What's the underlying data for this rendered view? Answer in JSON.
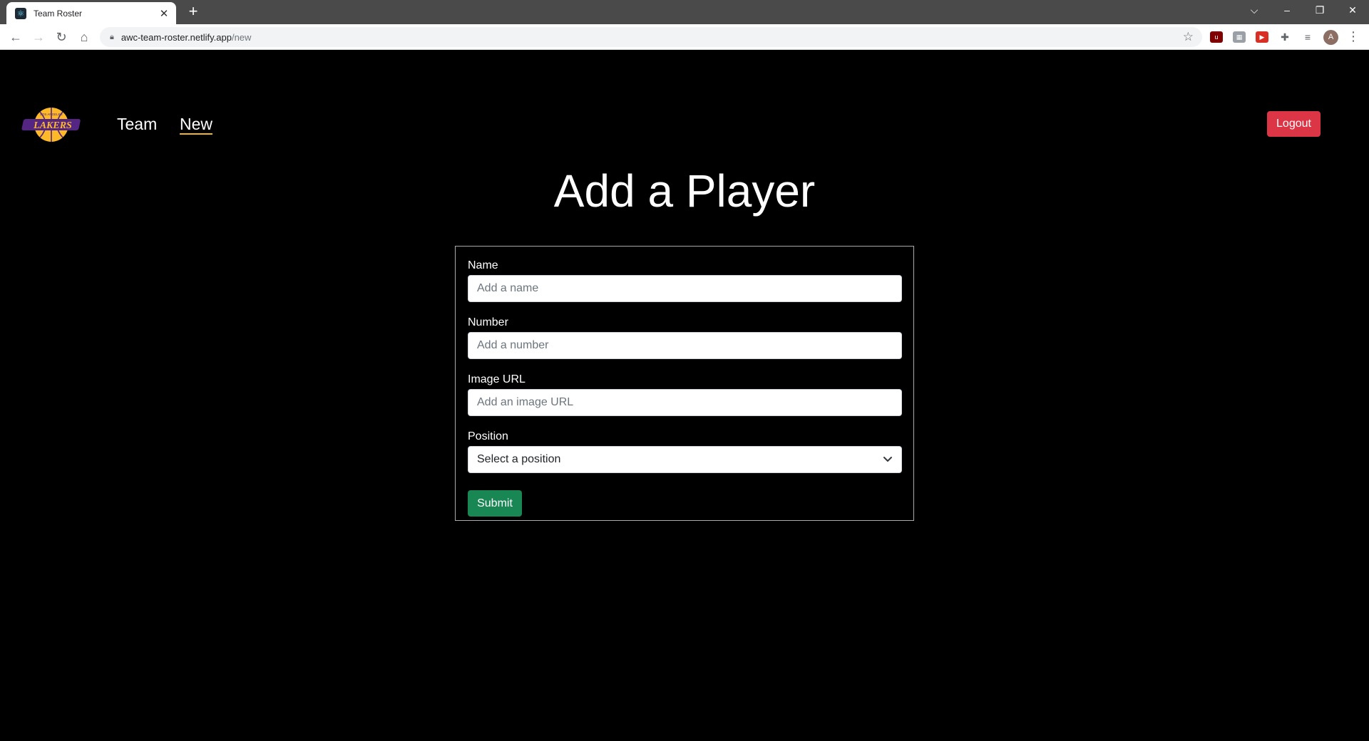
{
  "browser": {
    "tab_title": "Team Roster",
    "tab_close": "✕",
    "new_tab": "+",
    "url_host": "awc-team-roster.netlify.app",
    "url_path": "/new",
    "avatar_letter": "A",
    "window_controls": {
      "dropdown": "⌵",
      "minimize": "–",
      "restore": "❐",
      "close": "✕"
    },
    "extensions": [
      "ublock-icon",
      "grid-icon",
      "youtube-icon",
      "puzzle-icon",
      "queue-icon"
    ]
  },
  "nav": {
    "logo_alt": "Lakers logo",
    "links": [
      {
        "label": "Team"
      },
      {
        "label": "New",
        "active": true
      }
    ],
    "logout_label": "Logout"
  },
  "page": {
    "title": "Add a Player"
  },
  "form": {
    "name": {
      "label": "Name",
      "placeholder": "Add a name",
      "value": ""
    },
    "number": {
      "label": "Number",
      "placeholder": "Add a number",
      "value": ""
    },
    "image_url": {
      "label": "Image URL",
      "placeholder": "Add an image URL",
      "value": ""
    },
    "position": {
      "label": "Position",
      "selected": "Select a position"
    },
    "submit_label": "Submit"
  },
  "colors": {
    "background": "#000000",
    "logout": "#dc3545",
    "submit": "#198754",
    "lakers_purple": "#552583",
    "lakers_gold": "#FDB927"
  }
}
